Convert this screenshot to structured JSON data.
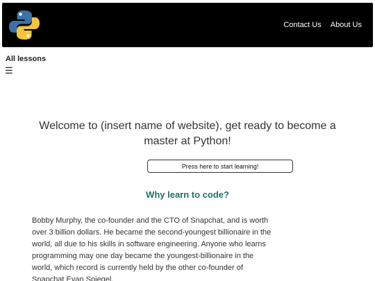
{
  "header": {
    "logo_icon": "python-logo-icon",
    "nav": [
      {
        "label": "Contact Us"
      },
      {
        "label": "About Us"
      }
    ]
  },
  "sidebar": {
    "title": "All lessons",
    "menu_icon": "hamburger-menu-icon"
  },
  "main": {
    "welcome_text": "Welcome to (insert name of website), get ready to become a master at Python!",
    "start_button_label": "Press here to start learning!",
    "section_heading": "Why learn to code?",
    "section_body": "Bobby Murphy, the co-founder and the CTO of Snapchat, and is worth over 3 billion dollars. He became the second-youngest billionaire in the world, all due to his skills in software engineering. Anyone who learns programming may one day became the youngest-billionaire in the world, which record is currently held by the other co-founder of Snapchat Evan Spiegel."
  },
  "colors": {
    "header_bg": "#000000",
    "heading_accent": "#1f6f6b",
    "python_blue": "#3a72a8",
    "python_yellow": "#f3c53a"
  }
}
